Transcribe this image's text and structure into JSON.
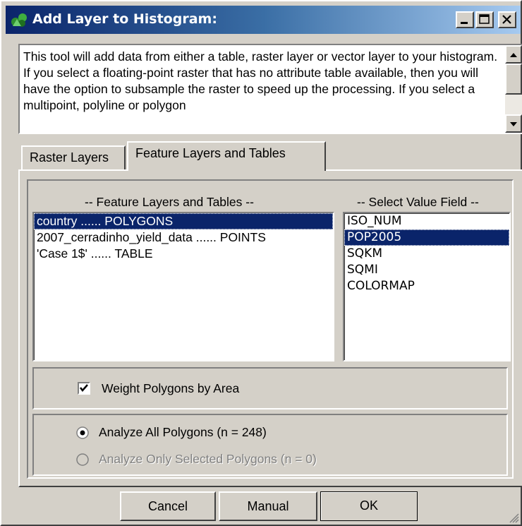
{
  "window": {
    "title": "Add Layer to Histogram:",
    "title_icon": "layers-app-icon",
    "controls": [
      "minimize-icon",
      "maximize-icon",
      "close-icon"
    ]
  },
  "description": {
    "text": "This tool will add data from either a table, raster layer or vector layer to your histogram.  If you select a floating-point raster that has no attribute table available, then you will have the option to subsample the raster to speed up the processing.  If you select a multipoint, polyline or polygon"
  },
  "tabs": [
    {
      "label": "Raster Layers",
      "active": false
    },
    {
      "label": "Feature Layers and Tables",
      "active": true
    }
  ],
  "feature_list": {
    "header": "-- Feature Layers and Tables --",
    "items": [
      "country ...... POLYGONS",
      "2007_cerradinho_yield_data ...... POINTS",
      "'Case 1$' ...... TABLE"
    ],
    "selected_index": 0
  },
  "value_field": {
    "header": "-- Select Value Field --",
    "items": [
      "ISO_NUM",
      "POP2005",
      "SQKM",
      "SQMI",
      "COLORMAP"
    ],
    "selected_index": 1
  },
  "weight": {
    "label": "Weight Polygons by Area",
    "checked": true
  },
  "analyze": {
    "all_label": "Analyze All Polygons (n = 248)",
    "selected_label": "Analyze Only Selected Polygons (n = 0)",
    "all_selected": true,
    "selected_enabled": false
  },
  "buttons": {
    "cancel": "Cancel",
    "manual": "Manual",
    "ok": "OK"
  },
  "colors": {
    "title_start": "#0a246a",
    "title_end": "#a6caf0",
    "selection": "#0a246a",
    "face": "#d4d0c8"
  }
}
